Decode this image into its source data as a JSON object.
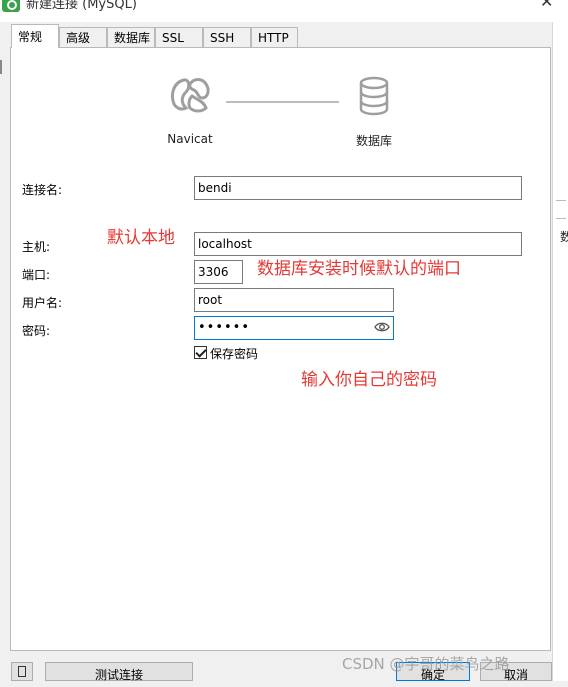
{
  "window": {
    "title": "新建连接 (MySQL)"
  },
  "tabs": [
    {
      "label": "常规",
      "active": true
    },
    {
      "label": "高级"
    },
    {
      "label": "数据库"
    },
    {
      "label": "SSL"
    },
    {
      "label": "SSH"
    },
    {
      "label": "HTTP"
    }
  ],
  "diagram": {
    "left_label": "Navicat",
    "right_label": "数据库"
  },
  "form": {
    "connection_name": {
      "label": "连接名:",
      "value": "bendi"
    },
    "host": {
      "label": "主机:",
      "value": "localhost"
    },
    "port": {
      "label": "端口:",
      "value": "3306"
    },
    "username": {
      "label": "用户名:",
      "value": "root"
    },
    "password": {
      "label": "密码:",
      "value": "••••••"
    },
    "save_password": {
      "label": "保存密码",
      "checked": true
    }
  },
  "annotations": {
    "host_note": "默认本地",
    "port_note": "数据库安装时候默认的端口",
    "password_note": "输入你自己的密码"
  },
  "buttons": {
    "test": "测试连接",
    "ok": "确定",
    "cancel": "取消"
  },
  "watermark": "CSDN @宇哥的菜鸟之路",
  "colors": {
    "annotation": "#e53935",
    "focus": "#0078d7",
    "icon_gray": "#9e9e9e"
  }
}
